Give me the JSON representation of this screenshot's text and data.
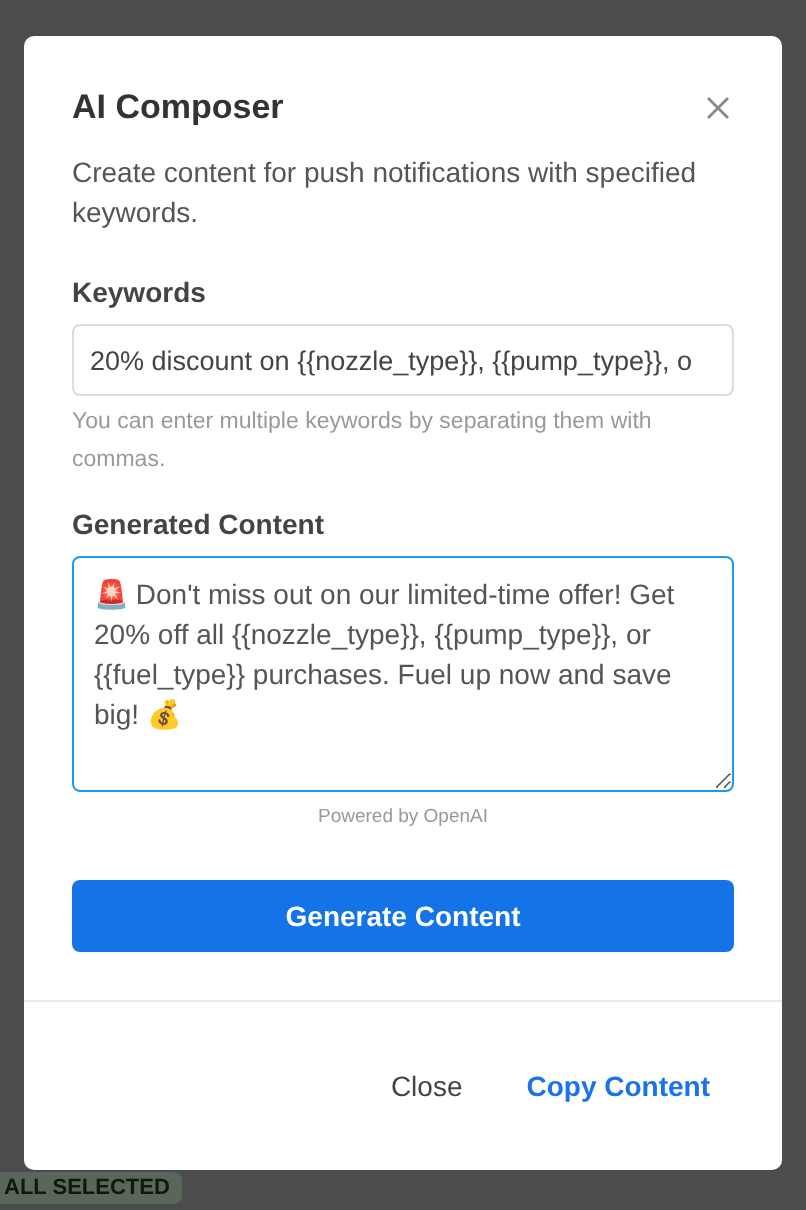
{
  "background": {
    "badge": "ALL SELECTED"
  },
  "dialog": {
    "title": "AI Composer",
    "subtitle": "Create content for push notifications with specified keywords.",
    "keywords": {
      "label": "Keywords",
      "value": "20% discount on {{nozzle_type}}, {{pump_type}}, o",
      "hint": "You can enter multiple keywords by separating them with commas."
    },
    "generated": {
      "label": "Generated Content",
      "value": "🚨 Don't miss out on our limited-time offer! Get 20% off all {{nozzle_type}}, {{pump_type}}, or {{fuel_type}} purchases. Fuel up now and save big! 💰",
      "focused": true
    },
    "powered_by": "Powered by OpenAI",
    "generate_button": "Generate Content",
    "footer_buttons": [
      {
        "label": "Close",
        "kind": "secondary"
      },
      {
        "label": "Copy Content",
        "kind": "primary"
      }
    ]
  }
}
